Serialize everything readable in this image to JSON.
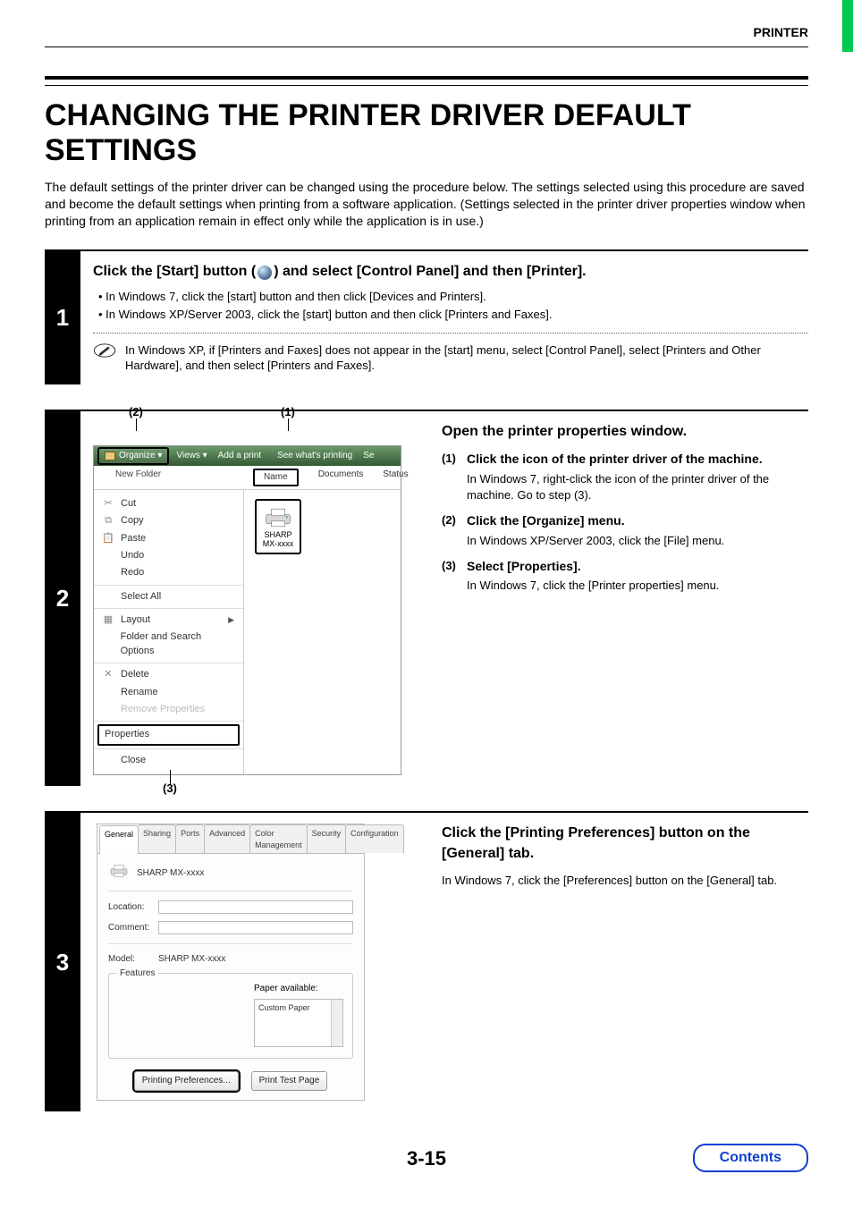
{
  "header": {
    "section": "PRINTER"
  },
  "title": "CHANGING THE PRINTER DRIVER DEFAULT SETTINGS",
  "intro": "The default settings of the printer driver can be changed using the procedure below. The settings selected using this procedure are saved and become the default settings when printing from a software application. (Settings selected in the printer driver properties window when printing from an application remain in effect only while the application is in use.)",
  "step1": {
    "num": "1",
    "title_pre": "Click the [Start] button (",
    "title_post": ") and select [Control Panel] and then [Printer].",
    "bullets": [
      "• In Windows 7, click the [start] button and then click [Devices and Printers].",
      "• In Windows XP/Server 2003, click the [start] button and then click [Printers and Faxes]."
    ],
    "note": "In Windows XP, if [Printers and Faxes] does not appear in the [start] menu, select [Control Panel], select [Printers and Other Hardware], and then select [Printers and Faxes]."
  },
  "step2": {
    "num": "2",
    "right_title": "Open the printer properties window.",
    "items": [
      {
        "n": "(1)",
        "head": "Click the icon of the printer driver of the machine.",
        "desc": "In Windows 7, right-click the icon of the printer driver of the machine. Go to step (3)."
      },
      {
        "n": "(2)",
        "head": "Click the [Organize] menu.",
        "desc": "In Windows XP/Server 2003, click the [File] menu."
      },
      {
        "n": "(3)",
        "head": "Select [Properties].",
        "desc": "In Windows 7, click the [Printer properties] menu."
      }
    ],
    "callouts": {
      "c1": "(1)",
      "c2": "(2)",
      "c3": "(3)"
    },
    "explorer": {
      "toolbar": {
        "organize": "Organize ▾",
        "views": "Views ▾",
        "add": "Add a print",
        "see": "See what's printing",
        "sel": "Se"
      },
      "newfolder": "New Folder",
      "columns": {
        "name": "Name",
        "docs": "Documents",
        "status": "Status"
      },
      "menu": [
        "Cut",
        "Copy",
        "Paste",
        "Undo",
        "Redo",
        "Select All",
        "Layout",
        "Folder and Search Options",
        "Delete",
        "Rename",
        "Remove Properties",
        "Properties",
        "Close"
      ],
      "printer": {
        "l1": "SHARP",
        "l2": "MX-xxxx"
      }
    }
  },
  "step3": {
    "num": "3",
    "right_title": "Click the [Printing Preferences] button on the [General] tab.",
    "right_desc": "In Windows 7, click the [Preferences] button on the [General] tab.",
    "tabs": [
      "General",
      "Sharing",
      "Ports",
      "Advanced",
      "Color Management",
      "Security",
      "Configuration"
    ],
    "printer_name": "SHARP MX-xxxx",
    "labels": {
      "location": "Location:",
      "comment": "Comment:",
      "model": "Model:",
      "features": "Features",
      "paper": "Paper available:",
      "custom": "Custom Paper"
    },
    "buttons": {
      "prefs": "Printing Preferences...",
      "test": "Print Test Page"
    }
  },
  "footer": {
    "pagenum": "3-15",
    "contents": "Contents"
  }
}
